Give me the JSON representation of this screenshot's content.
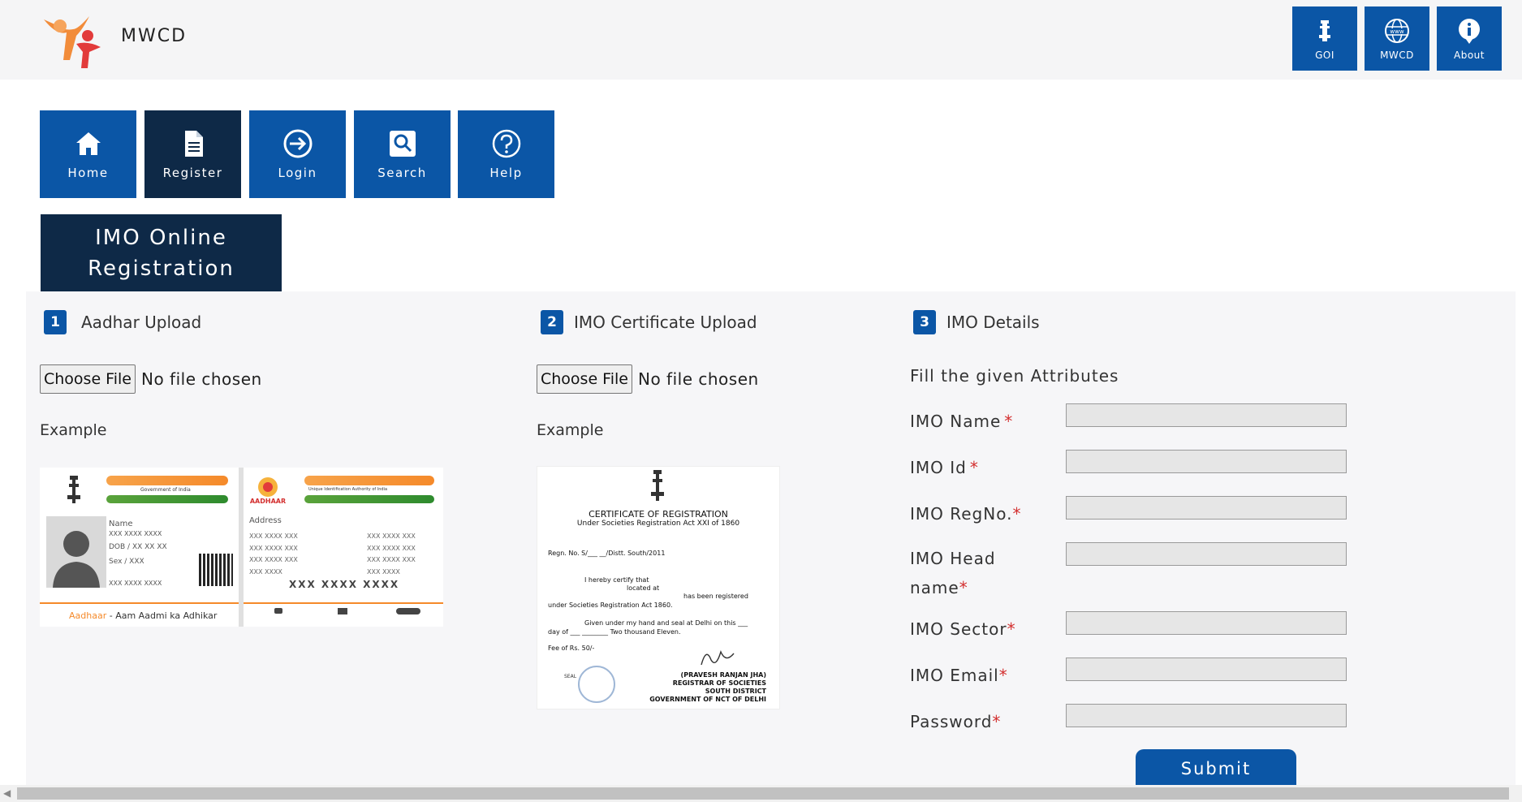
{
  "header": {
    "brand": "MWCD",
    "buttons": [
      {
        "label": "GOI",
        "icon": "emblem-icon"
      },
      {
        "label": "MWCD",
        "icon": "globe-www-icon"
      },
      {
        "label": "About",
        "icon": "info-icon"
      }
    ]
  },
  "nav": [
    {
      "label": "Home",
      "icon": "home-icon",
      "active": false
    },
    {
      "label": "Register",
      "icon": "document-icon",
      "active": true
    },
    {
      "label": "Login",
      "icon": "login-arrow-icon",
      "active": false
    },
    {
      "label": "Search",
      "icon": "search-icon",
      "active": false
    },
    {
      "label": "Help",
      "icon": "help-icon",
      "active": false
    }
  ],
  "page_title": "IMO Online Registration",
  "steps": [
    {
      "num": "1",
      "label": "Aadhar Upload"
    },
    {
      "num": "2",
      "label": "IMO Certificate Upload"
    },
    {
      "num": "3",
      "label": "IMO Details"
    }
  ],
  "upload": {
    "button": "Choose File",
    "status": "No file chosen",
    "example": "Example"
  },
  "aadhaar_card": {
    "gov_small": "Government of India",
    "uid_small": "Unique Identification Authority of India",
    "name_label": "Name",
    "masked_short": "XXX XXXX XXXX",
    "dob": "DOB / XX XX XX",
    "sex": "Sex / XXX",
    "address_label": "Address",
    "addr_line": "XXX XXXX XXX",
    "addr_line_short": "XXX XXXX",
    "number": "XXX XXXX XXXX",
    "tagline_left": "Aadhaar",
    "tagline_right": " - Aam Aadmi ka Adhikar",
    "logo_text": "AADHAAR"
  },
  "certificate": {
    "title": "CERTIFICATE OF REGISTRATION",
    "subtitle": "Under Societies Registration Act XXI of 1860",
    "regn": "Regn. No. S/___  __/Distt. South/2011",
    "l1": "I hereby certify that",
    "l2": "located at",
    "l3": "has been registered",
    "l4": "under Societies Registration Act 1860.",
    "l5": "Given under my hand and seal at Delhi on this ___",
    "l6": "day of ___ ________ Two thousand Eleven.",
    "fee": "Fee of Rs. 50/-",
    "seal": "SEAL",
    "sig1": "(PRAVESH RANJAN JHA)",
    "sig2": "REGISTRAR OF SOCIETIES",
    "sig3": "SOUTH DISTRICT",
    "sig4": "GOVERNMENT OF NCT OF DELHI"
  },
  "details": {
    "instruction": "Fill the given Attributes",
    "fields": [
      {
        "label": "IMO Name",
        "value": ""
      },
      {
        "label": "IMO Id",
        "value": ""
      },
      {
        "label": "IMO RegNo.",
        "value": ""
      },
      {
        "label": "IMO Head name",
        "value": ""
      },
      {
        "label": "IMO Sector",
        "value": ""
      },
      {
        "label": "IMO Email",
        "value": ""
      },
      {
        "label": "Password",
        "value": ""
      }
    ],
    "submit": "Submit"
  },
  "colors": {
    "primary": "#0b56a6",
    "dark": "#0e2947",
    "required": "#d32f2f",
    "panel": "#f6f6f8"
  }
}
